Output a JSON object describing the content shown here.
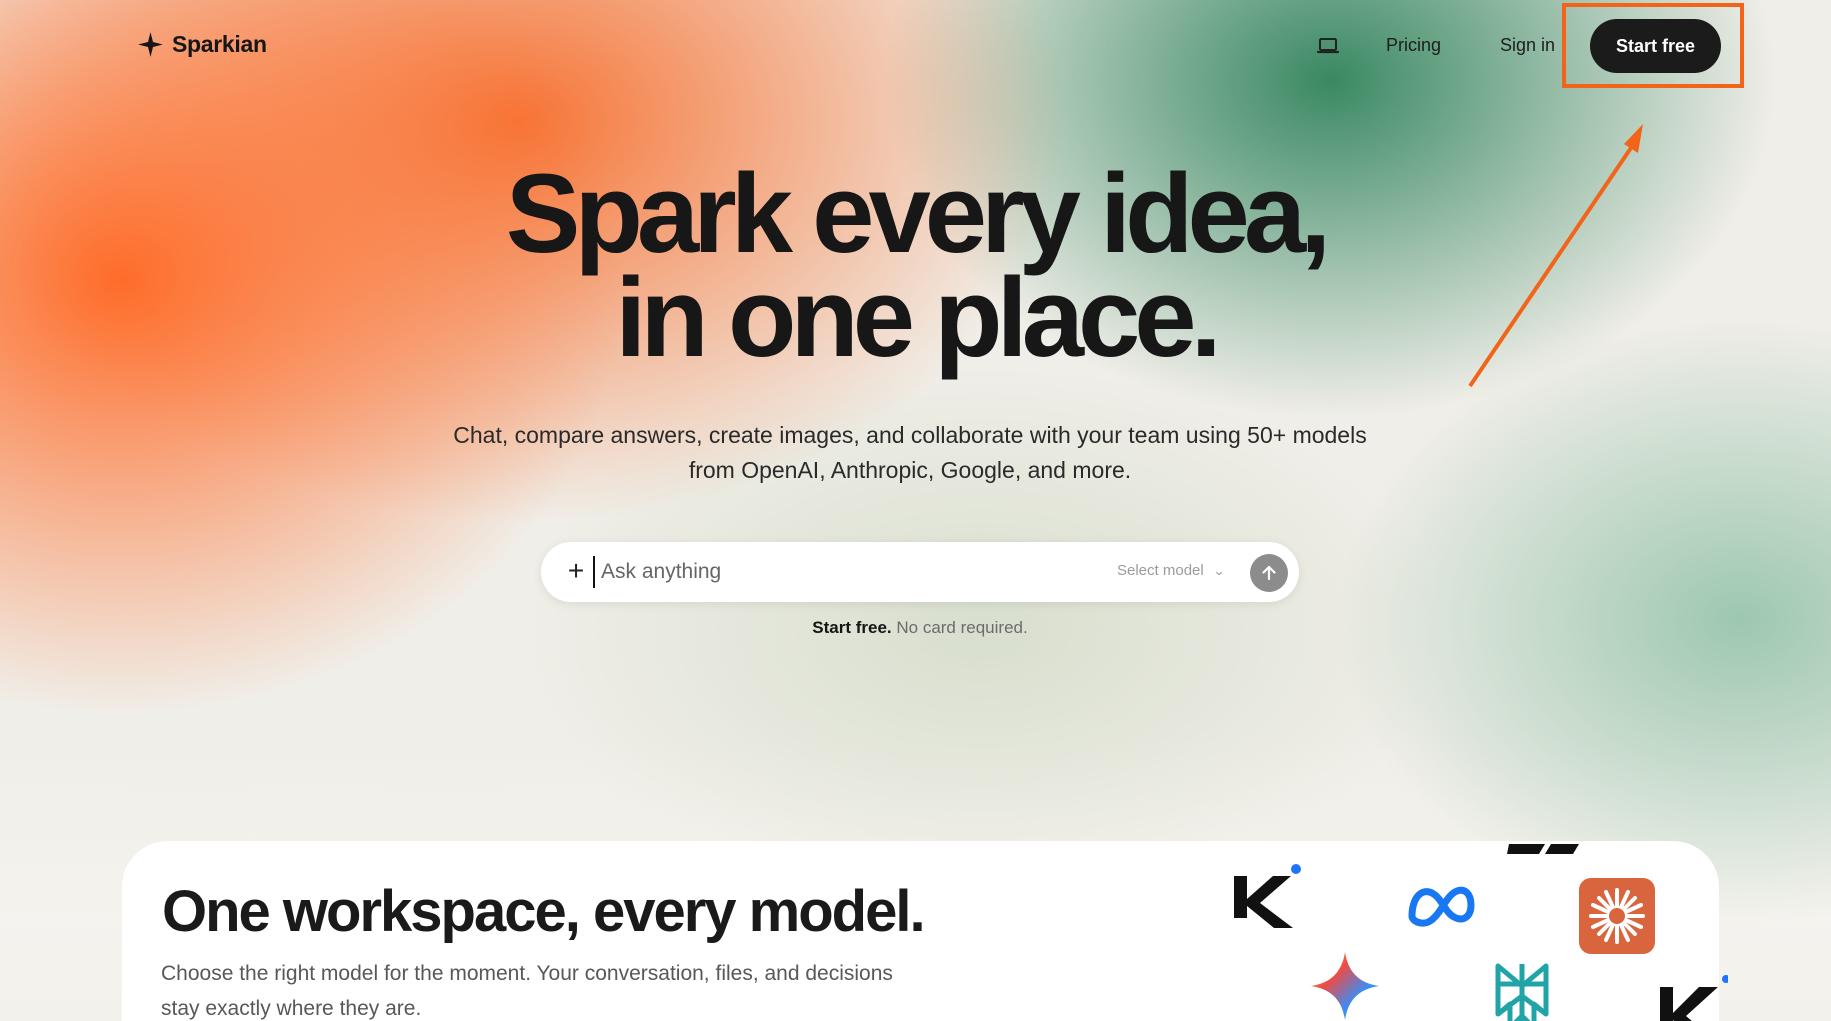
{
  "nav": {
    "brand": "Sparkian",
    "pricing": "Pricing",
    "sign_in": "Sign in",
    "start_free": "Start free"
  },
  "hero": {
    "title_line_1": "Spark every idea,",
    "title_line_2": "in one place.",
    "subtitle_line_1": "Chat, compare answers, create images, and collaborate with your team using 50+ models",
    "subtitle_line_2": "from OpenAI, Anthropic, Google, and more."
  },
  "prompt": {
    "placeholder": "Ask anything",
    "model_label": "Select model",
    "helper_strong": "Start free.",
    "helper_text": " No card required."
  },
  "section": {
    "title": "One workspace, every model.",
    "body": "Choose the right model for the moment. Your conversation, files, and decisions stay exactly where they are."
  },
  "logos": [
    "kimi-logo",
    "meta-logo",
    "claude-logo",
    "gemini-logo",
    "perplexity-logo",
    "kimi-logo"
  ],
  "colors": {
    "accent_orange": "#f26419",
    "dark_button": "#1b1b1b",
    "green": "#2a8058",
    "claude_orange": "#d9653e"
  }
}
